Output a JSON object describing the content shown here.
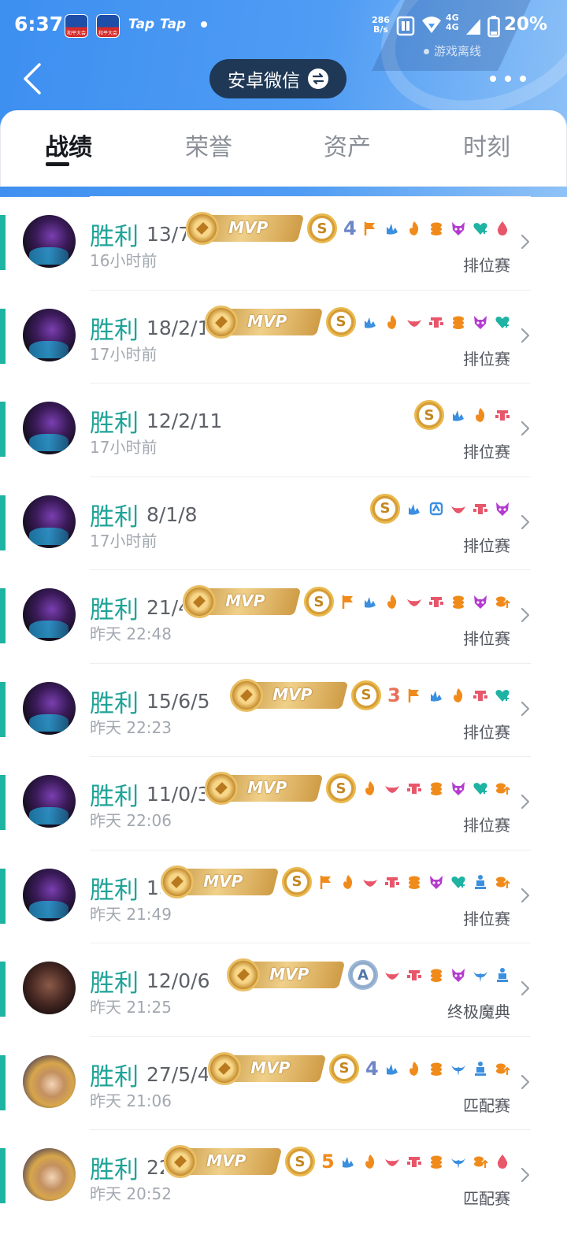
{
  "status_bar": {
    "time": "6:37",
    "app1_caption": "和平大会",
    "app2_caption": "和平大会",
    "tap1": "Tap",
    "tap2": "Tap",
    "speed_value": "286",
    "speed_unit": "B/s",
    "net1": "4G",
    "net2": "4G",
    "battery": "20%",
    "game_status": "游戏离线"
  },
  "header": {
    "account": "安卓微信"
  },
  "tabs": [
    {
      "label": "战绩",
      "active": true
    },
    {
      "label": "荣誉",
      "active": false
    },
    {
      "label": "资产",
      "active": false
    },
    {
      "label": "时刻",
      "active": false
    }
  ],
  "matches": [
    {
      "result": "胜利",
      "kda": "13/7/1",
      "time": "16小时前",
      "mode": "排位赛",
      "mvp": true,
      "rank": "S",
      "kill": "4",
      "avatar": "dark",
      "icons": [
        "flag",
        "tree",
        "fire",
        "coins",
        "demon",
        "heart",
        "drop"
      ]
    },
    {
      "result": "胜利",
      "kda": "18/2/14",
      "time": "17小时前",
      "mode": "排位赛",
      "mvp": true,
      "rank": "S",
      "kill": "",
      "avatar": "dark",
      "icons": [
        "tree",
        "fire",
        "wing",
        "tower",
        "coins",
        "demon",
        "heart"
      ]
    },
    {
      "result": "胜利",
      "kda": "12/2/11",
      "time": "17小时前",
      "mode": "排位赛",
      "mvp": false,
      "rank": "S",
      "kill": "",
      "avatar": "dark",
      "icons": [
        "tree",
        "fire",
        "tower"
      ]
    },
    {
      "result": "胜利",
      "kda": "8/1/8",
      "time": "17小时前",
      "mode": "排位赛",
      "mvp": false,
      "rank": "S",
      "kill": "",
      "avatar": "dark",
      "icons": [
        "tree",
        "tree2",
        "wing",
        "tower",
        "demon"
      ]
    },
    {
      "result": "胜利",
      "kda": "21/4/1",
      "time": "昨天 22:48",
      "mode": "排位赛",
      "mvp": true,
      "rank": "S",
      "kill": "",
      "avatar": "dark",
      "icons": [
        "flag",
        "tree",
        "fire",
        "wing",
        "tower",
        "coins",
        "demon",
        "coinup"
      ]
    },
    {
      "result": "胜利",
      "kda": "15/6/5",
      "time": "昨天 22:23",
      "mode": "排位赛",
      "mvp": true,
      "rank": "S",
      "kill": "3",
      "avatar": "dark",
      "icons": [
        "flag",
        "tree",
        "fire",
        "tower",
        "heart"
      ]
    },
    {
      "result": "胜利",
      "kda": "11/0/3",
      "time": "昨天 22:06",
      "mode": "排位赛",
      "mvp": true,
      "rank": "S",
      "kill": "",
      "avatar": "dark",
      "icons": [
        "fire",
        "wing",
        "tower",
        "coins",
        "demon",
        "heart",
        "coinup"
      ]
    },
    {
      "result": "胜利",
      "kda": "15/0/",
      "time": "昨天 21:49",
      "mode": "排位赛",
      "mvp": true,
      "rank": "S",
      "kill": "",
      "avatar": "dark",
      "icons": [
        "flag",
        "fire",
        "wing",
        "tower",
        "coins",
        "demon",
        "heart",
        "statue",
        "coinup"
      ]
    },
    {
      "result": "胜利",
      "kda": "12/0/6",
      "time": "昨天 21:25",
      "mode": "终极魔典",
      "mvp": true,
      "rank": "A",
      "kill": "",
      "avatar": "brown",
      "icons": [
        "wing",
        "tower",
        "coins",
        "demon",
        "bird",
        "statue"
      ]
    },
    {
      "result": "胜利",
      "kda": "27/5/4",
      "time": "昨天 21:06",
      "mode": "匹配赛",
      "mvp": true,
      "rank": "S",
      "kill": "4",
      "avatar": "blond",
      "icons": [
        "tree",
        "fire",
        "coins",
        "bird",
        "statue",
        "coinup"
      ]
    },
    {
      "result": "胜利",
      "kda": "22/1/",
      "time": "昨天 20:52",
      "mode": "匹配赛",
      "mvp": true,
      "rank": "S",
      "kill": "5",
      "avatar": "blond",
      "icons": [
        "tree",
        "fire",
        "wing",
        "tower",
        "coins",
        "bird",
        "coinup",
        "drop"
      ]
    }
  ],
  "icon_colors": {
    "accent_green": "#1fa398",
    "mvp_gold": "#d9a94f",
    "orange": "#f08b1b",
    "blue": "#3b8fe0",
    "pink": "#e8566a",
    "purple": "#b43ad0",
    "teal": "#1fb3a4"
  }
}
